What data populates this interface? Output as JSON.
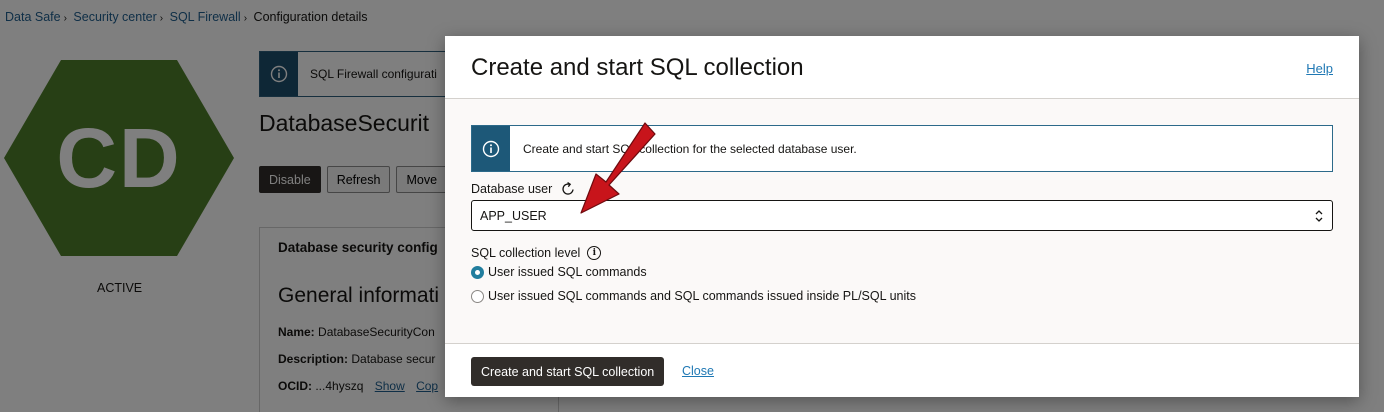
{
  "breadcrumb": {
    "items": [
      "Data Safe",
      "Security center",
      "SQL Firewall"
    ],
    "current": "Configuration details",
    "separator": "›"
  },
  "resource": {
    "initials": "CD",
    "status": "ACTIVE",
    "hex_color": "#4e7f2a"
  },
  "background": {
    "banner_text": "SQL Firewall configurati",
    "title": "DatabaseSecurit",
    "actions": [
      "Disable",
      "Refresh",
      "Move"
    ],
    "panel_title": "Database security config",
    "section_title": "General informati",
    "fields": {
      "name_label": "Name:",
      "name_value": "DatabaseSecurityCon",
      "description_label": "Description:",
      "description_value": "Database secur",
      "ocid_label": "OCID:",
      "ocid_value": "...4hyszq",
      "show_link": "Show",
      "copy_link": "Cop"
    }
  },
  "modal": {
    "title": "Create and start SQL collection",
    "help_link": "Help",
    "info_text": "Create and start SQL collection for the selected database user.",
    "database_user": {
      "label": "Database user",
      "value": "APP_USER"
    },
    "collection_level": {
      "label": "SQL collection level",
      "options": [
        {
          "label": "User issued SQL commands",
          "checked": true
        },
        {
          "label": "User issued SQL commands and SQL commands issued inside PL/SQL units",
          "checked": false
        }
      ]
    },
    "primary_button": "Create and start SQL collection",
    "close_link": "Close"
  },
  "colors": {
    "info_strip": "#1d5878",
    "accent_link": "#1f78b4",
    "primary_button": "#312d2a",
    "radio_checked": "#227e9e",
    "annotation_arrow": "#c8141b"
  },
  "icons": {
    "info": "info-icon",
    "refresh": "refresh-icon",
    "chevron": "up-down-chevron-icon",
    "annotation": "arrow-annotation"
  }
}
